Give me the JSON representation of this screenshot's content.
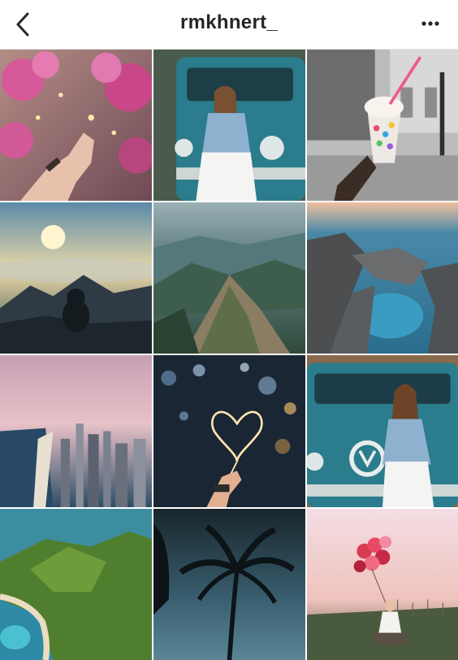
{
  "header": {
    "username": "rmkhnert_",
    "back_icon": "chevron-left-icon",
    "more_icon": "more-horizontal-icon"
  },
  "posts": [
    {
      "subject": "pink-bougainvillea-hand"
    },
    {
      "subject": "woman-teal-vw-van"
    },
    {
      "subject": "rainbow-ice-cream-cup-street"
    },
    {
      "subject": "mountain-sunrise-silhouette"
    },
    {
      "subject": "aerial-green-mountains"
    },
    {
      "subject": "rocky-coast-ocean-pool"
    },
    {
      "subject": "pink-sky-city-coastline"
    },
    {
      "subject": "heart-sparkler-city-bokeh"
    },
    {
      "subject": "woman-teal-vw-van-closeup"
    },
    {
      "subject": "aerial-green-island-beach"
    },
    {
      "subject": "palm-tree-silhouette-sky"
    },
    {
      "subject": "woman-red-balloons-sunset"
    }
  ],
  "colors": {
    "text": "#262626",
    "divider": "#e6e6e6"
  }
}
